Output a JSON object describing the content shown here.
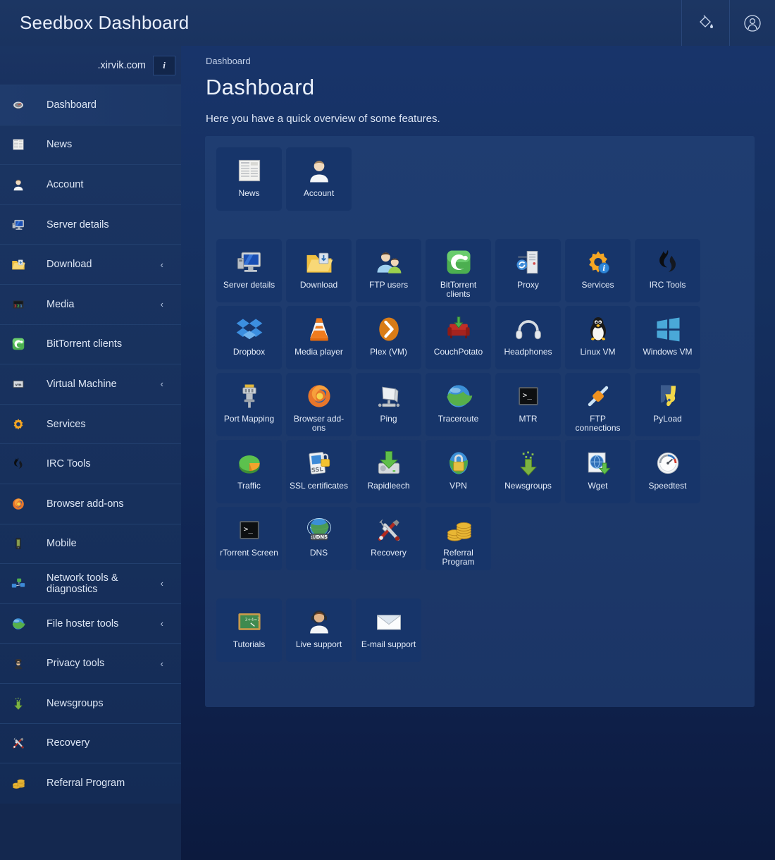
{
  "header": {
    "brand": "Seedbox Dashboard",
    "theme_icon": "paint-bucket-icon",
    "account_icon": "user-circle-icon"
  },
  "sidebar": {
    "domain": ".xirvik.com",
    "info_label": "i",
    "items": [
      {
        "label": "Dashboard",
        "icon": "gauge-icon",
        "chevron": "",
        "active": true
      },
      {
        "label": "News",
        "icon": "newspaper-icon",
        "chevron": ""
      },
      {
        "label": "Account",
        "icon": "user-icon",
        "chevron": ""
      },
      {
        "label": "Server details",
        "icon": "monitor-icon",
        "chevron": ""
      },
      {
        "label": "Download",
        "icon": "folder-download-icon",
        "chevron": "‹"
      },
      {
        "label": "Media",
        "icon": "media-icon",
        "chevron": "‹"
      },
      {
        "label": "BitTorrent clients",
        "icon": "bittorrent-icon",
        "chevron": ""
      },
      {
        "label": "Virtual Machine",
        "icon": "vm-icon",
        "chevron": "‹"
      },
      {
        "label": "Services",
        "icon": "gear-icon",
        "chevron": ""
      },
      {
        "label": "IRC Tools",
        "icon": "flame-icon",
        "chevron": ""
      },
      {
        "label": "Browser add-ons",
        "icon": "firefox-icon",
        "chevron": ""
      },
      {
        "label": "Mobile",
        "icon": "mobile-icon",
        "chevron": ""
      },
      {
        "label": "Network tools & diagnostics",
        "icon": "network-icon",
        "chevron": "‹"
      },
      {
        "label": "File hoster tools",
        "icon": "globe-icon",
        "chevron": "‹"
      },
      {
        "label": "Privacy tools",
        "icon": "spy-icon",
        "chevron": "‹"
      },
      {
        "label": "Newsgroups",
        "icon": "down-arrow-icon",
        "chevron": ""
      },
      {
        "label": "Recovery",
        "icon": "tools-icon",
        "chevron": ""
      },
      {
        "label": "Referral Program",
        "icon": "coins-icon",
        "chevron": ""
      }
    ]
  },
  "main": {
    "breadcrumb": "Dashboard",
    "title": "Dashboard",
    "subtitle": "Here you have a quick overview of some features."
  },
  "tiles": {
    "row1": [
      {
        "label": "News",
        "icon": "newspaper-icon"
      },
      {
        "label": "Account",
        "icon": "user-icon"
      }
    ],
    "row2": [
      {
        "label": "Server details",
        "icon": "monitor-icon"
      },
      {
        "label": "Download",
        "icon": "folder-download-icon"
      },
      {
        "label": "FTP users",
        "icon": "users-icon"
      },
      {
        "label": "BitTorrent clients",
        "icon": "bittorrent-icon"
      },
      {
        "label": "Proxy",
        "icon": "server-proxy-icon"
      },
      {
        "label": "Services",
        "icon": "gear-info-icon"
      },
      {
        "label": "IRC Tools",
        "icon": "flame-icon"
      }
    ],
    "row3": [
      {
        "label": "Dropbox",
        "icon": "dropbox-icon"
      },
      {
        "label": "Media player",
        "icon": "vlc-cone-icon"
      },
      {
        "label": "Plex (VM)",
        "icon": "plex-icon"
      },
      {
        "label": "CouchPotato",
        "icon": "couch-icon"
      },
      {
        "label": "Headphones",
        "icon": "headphones-icon"
      },
      {
        "label": "Linux VM",
        "icon": "tux-icon"
      },
      {
        "label": "Windows VM",
        "icon": "windows-icon"
      }
    ],
    "row4": [
      {
        "label": "Port Mapping",
        "icon": "plug-icon"
      },
      {
        "label": "Browser add-ons",
        "icon": "firefox-icon"
      },
      {
        "label": "Ping",
        "icon": "ping-node-icon"
      },
      {
        "label": "Traceroute",
        "icon": "globe-icon"
      },
      {
        "label": "MTR",
        "icon": "terminal-icon"
      },
      {
        "label": "FTP connections",
        "icon": "cable-icon"
      },
      {
        "label": "PyLoad",
        "icon": "pyload-icon"
      }
    ],
    "row5": [
      {
        "label": "Traffic",
        "icon": "pie-chart-icon"
      },
      {
        "label": "SSL certificates",
        "icon": "ssl-lock-icon"
      },
      {
        "label": "Rapidleech",
        "icon": "drive-download-icon"
      },
      {
        "label": "VPN",
        "icon": "lock-globe-icon"
      },
      {
        "label": "Newsgroups",
        "icon": "down-arrow-icon"
      },
      {
        "label": "Wget",
        "icon": "page-download-icon"
      },
      {
        "label": "Speedtest",
        "icon": "speedometer-icon"
      }
    ],
    "row6": [
      {
        "label": "rTorrent Screen",
        "icon": "terminal-icon"
      },
      {
        "label": "DNS",
        "icon": "dns-globe-icon"
      },
      {
        "label": "Recovery",
        "icon": "tools-icon"
      },
      {
        "label": "Referral Program",
        "icon": "coins-icon"
      }
    ],
    "row7": [
      {
        "label": "Tutorials",
        "icon": "chalkboard-icon"
      },
      {
        "label": "Live support",
        "icon": "headset-agent-icon"
      },
      {
        "label": "E-mail support",
        "icon": "envelope-icon"
      }
    ]
  },
  "colors": {
    "page_background": "#0c1a3e",
    "sidebar": "#1b3563",
    "panel": "#1e3b6e",
    "tile": "#17356a",
    "text": "#e4ecf9"
  }
}
